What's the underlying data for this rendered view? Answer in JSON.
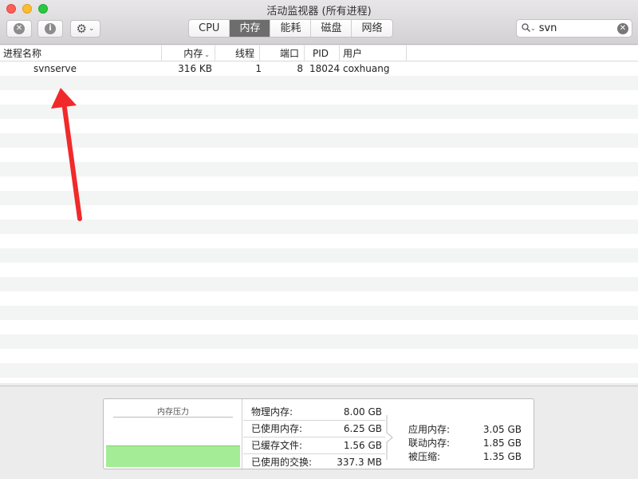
{
  "window": {
    "title": "活动监视器 (所有进程)"
  },
  "toolbar": {
    "stop_glyph": "✕",
    "info_glyph": "i",
    "gear_glyph": "⚙",
    "gear_caret": "⌄",
    "tabs": [
      {
        "label": "CPU",
        "active": false
      },
      {
        "label": "内存",
        "active": true
      },
      {
        "label": "能耗",
        "active": false
      },
      {
        "label": "磁盘",
        "active": false
      },
      {
        "label": "网络",
        "active": false
      }
    ],
    "search_value": "svn",
    "search_glyph": "🔍",
    "search_caret": "⌄",
    "clear_glyph": "✕"
  },
  "table": {
    "columns": {
      "name": "进程名称",
      "memory": "内存",
      "threads": "线程",
      "ports": "端口",
      "pid": "PID",
      "user": "用户"
    },
    "sort_caret": "⌄",
    "rows": [
      {
        "name": "svnserve",
        "memory": "316 KB",
        "threads": "1",
        "ports": "8",
        "pid": "18024",
        "user": "coxhuang"
      }
    ]
  },
  "memory_panel": {
    "pressure_title": "内存压力",
    "stats": [
      {
        "label": "物理内存:",
        "value": "8.00 GB"
      },
      {
        "label": "已使用内存:",
        "value": "6.25 GB"
      },
      {
        "label": "已缓存文件:",
        "value": "1.56 GB"
      },
      {
        "label": "已使用的交换:",
        "value": "337.3 MB"
      }
    ],
    "breakdown": [
      {
        "label": "应用内存:",
        "value": "3.05 GB"
      },
      {
        "label": "联动内存:",
        "value": "1.85 GB"
      },
      {
        "label": "被压缩:",
        "value": "1.35 GB"
      }
    ]
  },
  "colors": {
    "arrow": "#f02a2a",
    "pressure_green": "#a4ec96",
    "active_tab": "#6d6d6d"
  }
}
